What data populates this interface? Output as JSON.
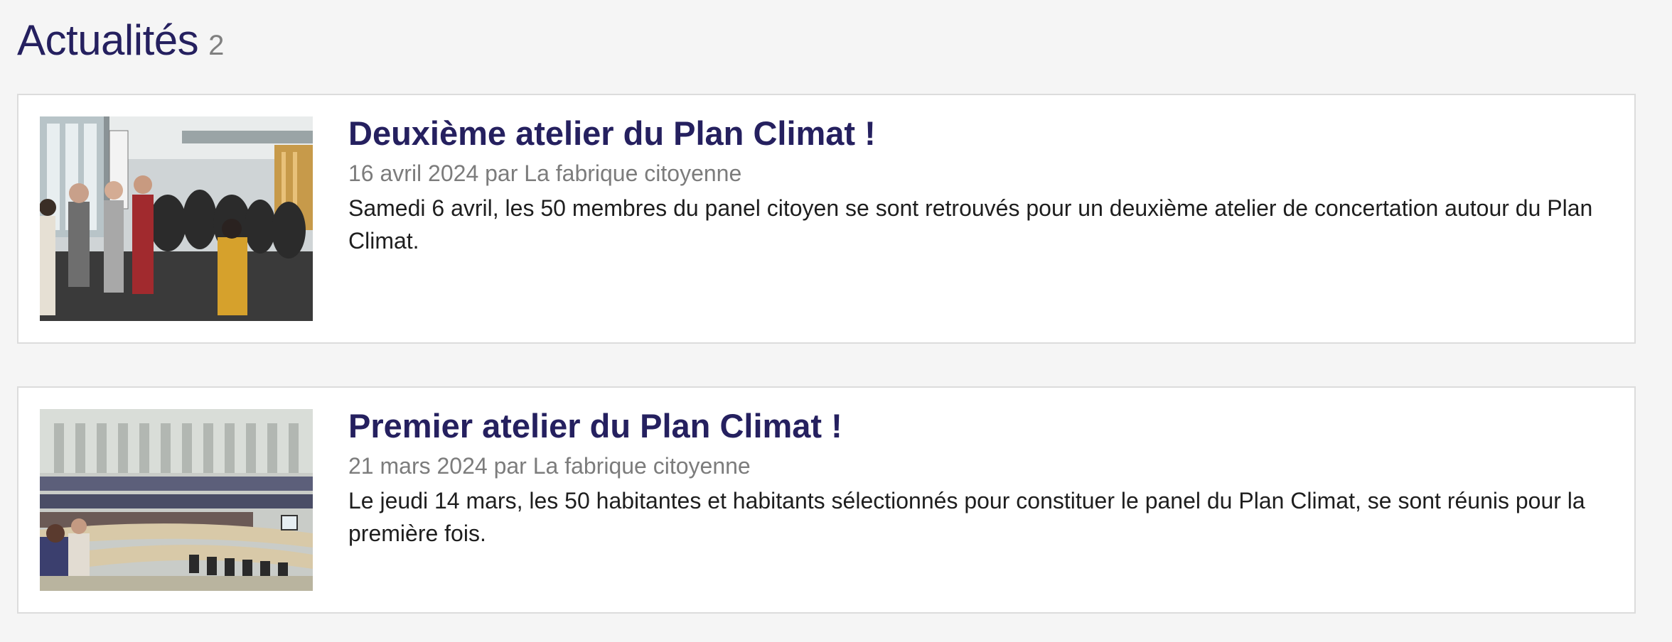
{
  "section": {
    "title": "Actualités",
    "count": "2"
  },
  "articles": [
    {
      "title": "Deuxième atelier du Plan Climat !",
      "date": "16 avril 2024",
      "by": "par",
      "author": "La fabrique citoyenne",
      "excerpt": "Samedi 6 avril, les 50 membres du panel citoyen se sont retrouvés pour un deuxième atelier de concertation autour du Plan Climat.",
      "image": "photo of participants gathered in a building hall"
    },
    {
      "title": "Premier atelier du Plan Climat !",
      "date": "21 mars 2024",
      "by": "par",
      "author": "La fabrique citoyenne",
      "excerpt": "Le jeudi 14 mars, les 50 habitantes et habitants sélectionnés pour constituer le panel du Plan Climat, se sont réunis pour la première fois.",
      "image": "photo of a council chamber with seated participants"
    }
  ],
  "colors": {
    "background": "#f5f5f5",
    "title": "#25205f",
    "meta": "#7c7c7c",
    "text": "#1e1e1e",
    "card_border": "#dcdcdc"
  }
}
